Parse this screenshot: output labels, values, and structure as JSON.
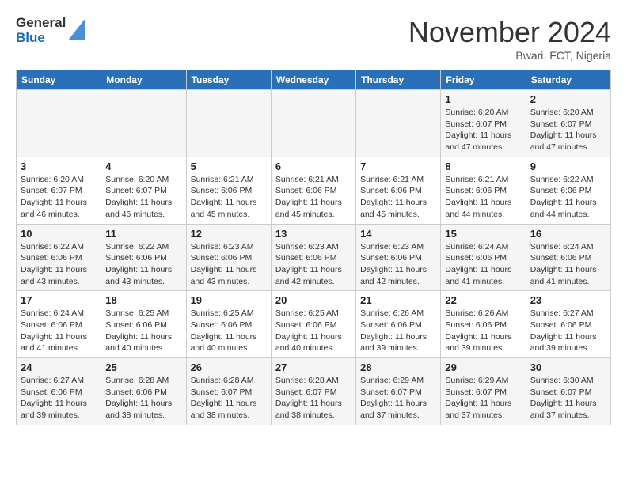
{
  "header": {
    "logo_line1": "General",
    "logo_line2": "Blue",
    "month": "November 2024",
    "location": "Bwari, FCT, Nigeria"
  },
  "days_of_week": [
    "Sunday",
    "Monday",
    "Tuesday",
    "Wednesday",
    "Thursday",
    "Friday",
    "Saturday"
  ],
  "weeks": [
    [
      {
        "day": "",
        "info": ""
      },
      {
        "day": "",
        "info": ""
      },
      {
        "day": "",
        "info": ""
      },
      {
        "day": "",
        "info": ""
      },
      {
        "day": "",
        "info": ""
      },
      {
        "day": "1",
        "info": "Sunrise: 6:20 AM\nSunset: 6:07 PM\nDaylight: 11 hours\nand 47 minutes."
      },
      {
        "day": "2",
        "info": "Sunrise: 6:20 AM\nSunset: 6:07 PM\nDaylight: 11 hours\nand 47 minutes."
      }
    ],
    [
      {
        "day": "3",
        "info": "Sunrise: 6:20 AM\nSunset: 6:07 PM\nDaylight: 11 hours\nand 46 minutes."
      },
      {
        "day": "4",
        "info": "Sunrise: 6:20 AM\nSunset: 6:07 PM\nDaylight: 11 hours\nand 46 minutes."
      },
      {
        "day": "5",
        "info": "Sunrise: 6:21 AM\nSunset: 6:06 PM\nDaylight: 11 hours\nand 45 minutes."
      },
      {
        "day": "6",
        "info": "Sunrise: 6:21 AM\nSunset: 6:06 PM\nDaylight: 11 hours\nand 45 minutes."
      },
      {
        "day": "7",
        "info": "Sunrise: 6:21 AM\nSunset: 6:06 PM\nDaylight: 11 hours\nand 45 minutes."
      },
      {
        "day": "8",
        "info": "Sunrise: 6:21 AM\nSunset: 6:06 PM\nDaylight: 11 hours\nand 44 minutes."
      },
      {
        "day": "9",
        "info": "Sunrise: 6:22 AM\nSunset: 6:06 PM\nDaylight: 11 hours\nand 44 minutes."
      }
    ],
    [
      {
        "day": "10",
        "info": "Sunrise: 6:22 AM\nSunset: 6:06 PM\nDaylight: 11 hours\nand 43 minutes."
      },
      {
        "day": "11",
        "info": "Sunrise: 6:22 AM\nSunset: 6:06 PM\nDaylight: 11 hours\nand 43 minutes."
      },
      {
        "day": "12",
        "info": "Sunrise: 6:23 AM\nSunset: 6:06 PM\nDaylight: 11 hours\nand 43 minutes."
      },
      {
        "day": "13",
        "info": "Sunrise: 6:23 AM\nSunset: 6:06 PM\nDaylight: 11 hours\nand 42 minutes."
      },
      {
        "day": "14",
        "info": "Sunrise: 6:23 AM\nSunset: 6:06 PM\nDaylight: 11 hours\nand 42 minutes."
      },
      {
        "day": "15",
        "info": "Sunrise: 6:24 AM\nSunset: 6:06 PM\nDaylight: 11 hours\nand 41 minutes."
      },
      {
        "day": "16",
        "info": "Sunrise: 6:24 AM\nSunset: 6:06 PM\nDaylight: 11 hours\nand 41 minutes."
      }
    ],
    [
      {
        "day": "17",
        "info": "Sunrise: 6:24 AM\nSunset: 6:06 PM\nDaylight: 11 hours\nand 41 minutes."
      },
      {
        "day": "18",
        "info": "Sunrise: 6:25 AM\nSunset: 6:06 PM\nDaylight: 11 hours\nand 40 minutes."
      },
      {
        "day": "19",
        "info": "Sunrise: 6:25 AM\nSunset: 6:06 PM\nDaylight: 11 hours\nand 40 minutes."
      },
      {
        "day": "20",
        "info": "Sunrise: 6:25 AM\nSunset: 6:06 PM\nDaylight: 11 hours\nand 40 minutes."
      },
      {
        "day": "21",
        "info": "Sunrise: 6:26 AM\nSunset: 6:06 PM\nDaylight: 11 hours\nand 39 minutes."
      },
      {
        "day": "22",
        "info": "Sunrise: 6:26 AM\nSunset: 6:06 PM\nDaylight: 11 hours\nand 39 minutes."
      },
      {
        "day": "23",
        "info": "Sunrise: 6:27 AM\nSunset: 6:06 PM\nDaylight: 11 hours\nand 39 minutes."
      }
    ],
    [
      {
        "day": "24",
        "info": "Sunrise: 6:27 AM\nSunset: 6:06 PM\nDaylight: 11 hours\nand 39 minutes."
      },
      {
        "day": "25",
        "info": "Sunrise: 6:28 AM\nSunset: 6:06 PM\nDaylight: 11 hours\nand 38 minutes."
      },
      {
        "day": "26",
        "info": "Sunrise: 6:28 AM\nSunset: 6:07 PM\nDaylight: 11 hours\nand 38 minutes."
      },
      {
        "day": "27",
        "info": "Sunrise: 6:28 AM\nSunset: 6:07 PM\nDaylight: 11 hours\nand 38 minutes."
      },
      {
        "day": "28",
        "info": "Sunrise: 6:29 AM\nSunset: 6:07 PM\nDaylight: 11 hours\nand 37 minutes."
      },
      {
        "day": "29",
        "info": "Sunrise: 6:29 AM\nSunset: 6:07 PM\nDaylight: 11 hours\nand 37 minutes."
      },
      {
        "day": "30",
        "info": "Sunrise: 6:30 AM\nSunset: 6:07 PM\nDaylight: 11 hours\nand 37 minutes."
      }
    ]
  ]
}
